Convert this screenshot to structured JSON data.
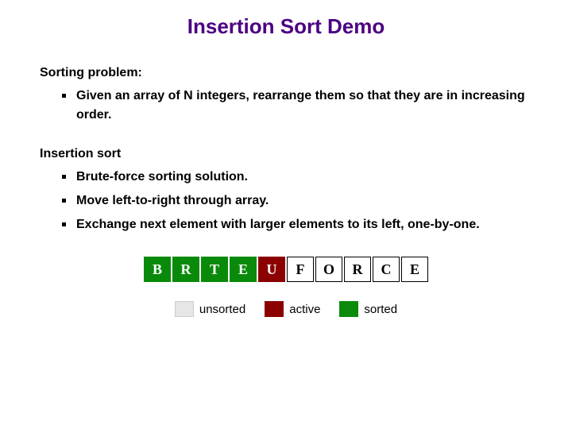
{
  "title": "Insertion Sort Demo",
  "sections": [
    {
      "heading": "Sorting problem:",
      "bullets": [
        "Given an array of N integers, rearrange them so that they are in increasing order."
      ]
    },
    {
      "heading": "Insertion sort",
      "bullets": [
        "Brute-force sorting solution.",
        "Move left-to-right through array.",
        "Exchange next element with larger elements to its left, one-by-one."
      ]
    }
  ],
  "array": [
    {
      "letter": "B",
      "state": "sorted"
    },
    {
      "letter": "R",
      "state": "sorted"
    },
    {
      "letter": "T",
      "state": "sorted"
    },
    {
      "letter": "E",
      "state": "sorted"
    },
    {
      "letter": "U",
      "state": "active"
    },
    {
      "letter": "F",
      "state": "unsorted"
    },
    {
      "letter": "O",
      "state": "unsorted"
    },
    {
      "letter": "R",
      "state": "unsorted"
    },
    {
      "letter": "C",
      "state": "unsorted"
    },
    {
      "letter": "E",
      "state": "unsorted"
    }
  ],
  "legend": {
    "unsorted": "unsorted",
    "active": "active",
    "sorted": "sorted"
  }
}
